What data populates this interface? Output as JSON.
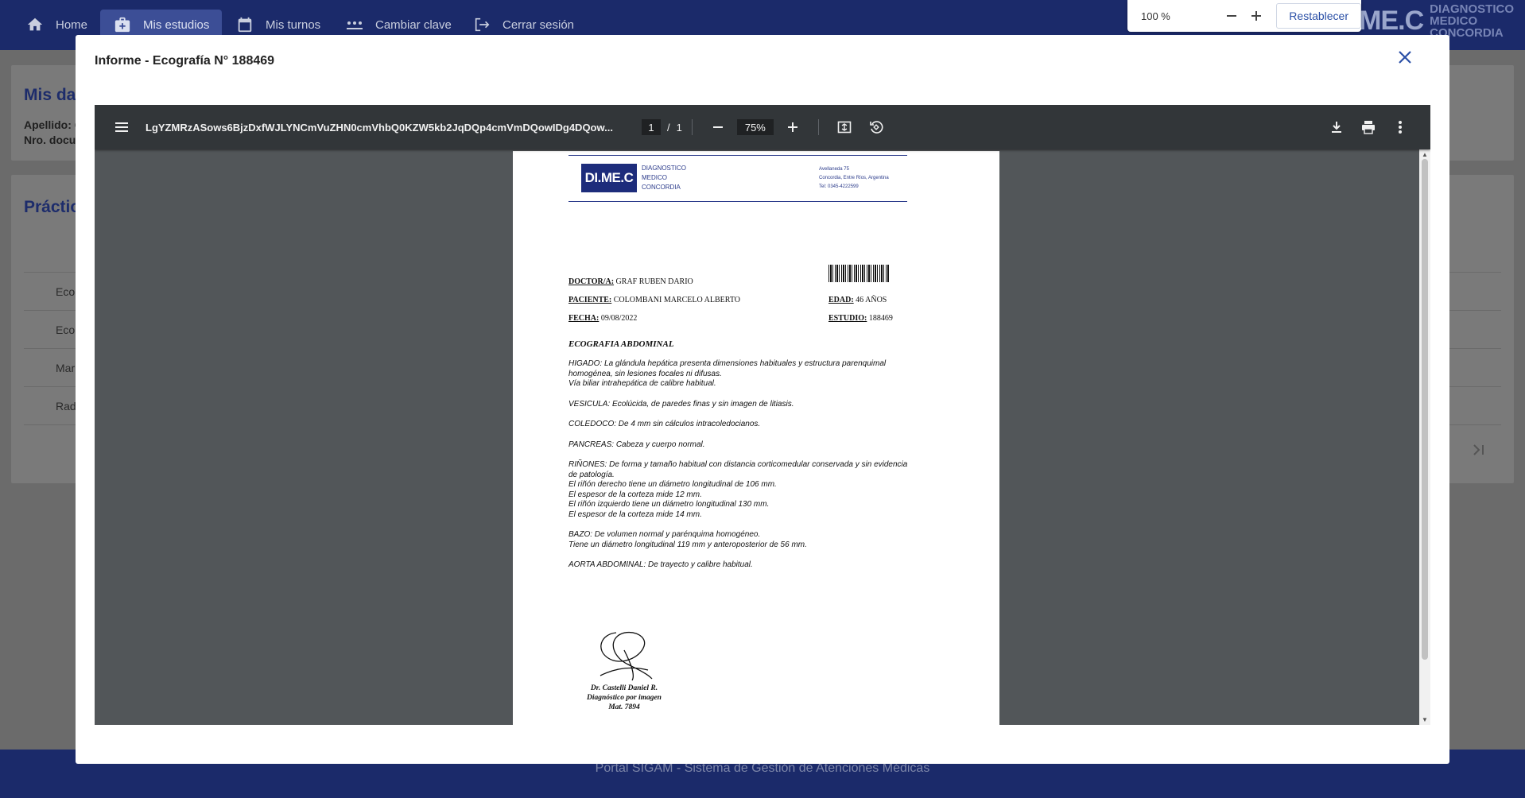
{
  "nav": {
    "items": [
      {
        "label": "Home",
        "icon": "home-icon"
      },
      {
        "label": "Mis estudios",
        "icon": "medical-bag-icon"
      },
      {
        "label": "Mis turnos",
        "icon": "calendar-icon"
      },
      {
        "label": "Cambiar clave",
        "icon": "password-icon"
      },
      {
        "label": "Cerrar sesión",
        "icon": "logout-icon"
      }
    ],
    "brand_mark": "DI.ME.C",
    "brand_line1": "DIAGNOSTICO",
    "brand_line2": "MEDICO",
    "brand_line3": "CONCORDIA"
  },
  "zoom": {
    "value": "100 %",
    "reset_label": "Restablecer"
  },
  "background": {
    "datos_title": "Mis dat",
    "apellido_label": "Apellido: C",
    "documento_label": "Nro. docum",
    "practicas_title": "Prácticas",
    "rows": [
      "Eco",
      "Eco",
      "Mar",
      "Rad"
    ],
    "footer": "Portal SIGAM - Sistema de Gestión de Atenciones Médicas"
  },
  "modal": {
    "title": "Informe - Ecografía N° 188469"
  },
  "pdf": {
    "filename": "LgYZMRzASows6BjzDxfWJLYNCmVuZHN0cmVhbQ0KZW5kb2JqDQp4cmVmDQowIDg4DQow...",
    "page_current": "1",
    "page_sep": "/",
    "page_total": "1",
    "zoom": "75%"
  },
  "doc": {
    "logo": "DI.ME.C",
    "org_line1": "DIAGNOSTICO",
    "org_line2": "MEDICO",
    "org_line3": "CONCORDIA",
    "addr_line1": "Avellaneda 75",
    "addr_line2": "Concordia, Entre Ríos, Argentina",
    "addr_line3": "Tel: 0345-4222599",
    "doctor_label": "DOCTOR/A:",
    "doctor_value": "GRAF RUBEN DARIO",
    "paciente_label": "PACIENTE:",
    "paciente_value": "COLOMBANI MARCELO ALBERTO",
    "fecha_label": "FECHA:",
    "fecha_value": "09/08/2022",
    "edad_label": "EDAD:",
    "edad_value": "46 AÑOS",
    "estudio_label": "ESTUDIO:",
    "estudio_value": "188469",
    "report_title": "ECOGRAFIA ABDOMINAL",
    "paragraphs": [
      [
        "HIGADO: La glándula hepática presenta dimensiones habituales y estructura parenquimal",
        "homogénea, sin lesiones focales ni difusas.",
        "Vía biliar intrahepática de calibre habitual."
      ],
      [
        "VESICULA: Ecolúcida, de paredes finas y sin imagen de litiasis."
      ],
      [
        "COLEDOCO: De 4 mm sin cálculos intracoledocianos."
      ],
      [
        "PANCREAS: Cabeza y cuerpo normal."
      ],
      [
        "RIÑONES: De forma y tamaño habitual con distancia corticomedular conservada y sin evidencia",
        "de patología.",
        "El riñón derecho tiene un diámetro longitudinal de 106 mm.",
        "El espesor de la corteza mide 12 mm.",
        "El riñón izquierdo tiene un diámetro longitudinal 130 mm.",
        "El espesor de la corteza mide 14 mm."
      ],
      [
        "BAZO: De volumen normal y parénquima homogéneo.",
        "Tiene un diámetro longitudinal 119 mm y anteroposterior de 56 mm."
      ],
      [
        "AORTA ABDOMINAL: De trayecto y calibre habitual."
      ]
    ],
    "sig_line1": "Dr. Castelli Daniel R.",
    "sig_line2": "Diagnóstico por imagen",
    "sig_line3": "Mat. 7894"
  },
  "colors": {
    "nav_bg": "#1b2a6a",
    "nav_active": "#3c4e96",
    "pdf_toolbar": "#323639",
    "pdf_bg": "#525659"
  }
}
